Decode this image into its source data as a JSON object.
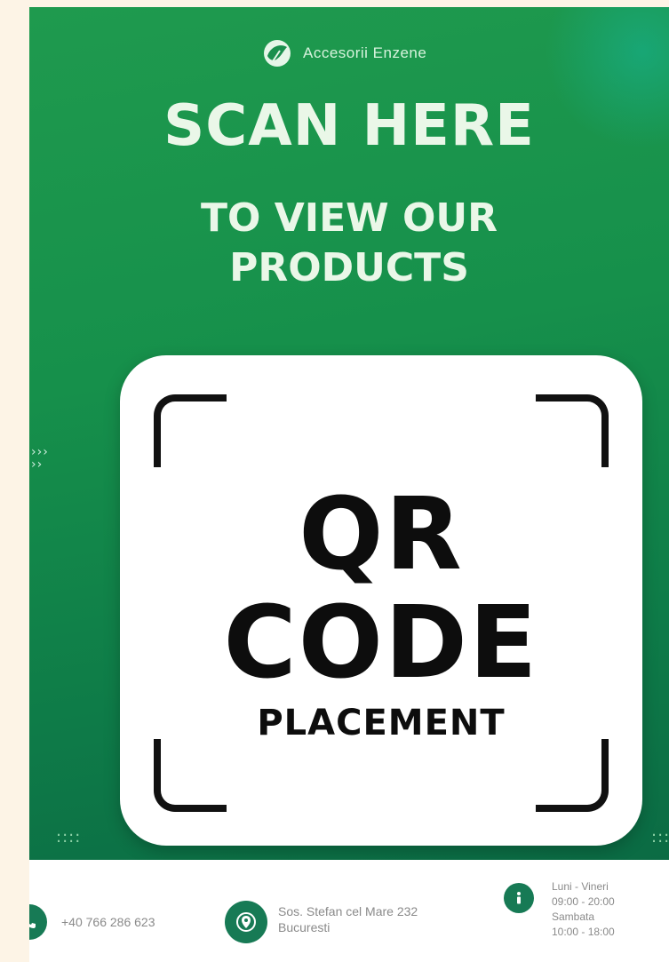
{
  "brand": {
    "name": "Accesorii Enzene",
    "logo_icon": "globe-leaf-icon"
  },
  "headline": "SCAN HERE",
  "subheadline": [
    "TO VIEW OUR",
    "PRODUCTS"
  ],
  "decor": {
    "arrows": "›››\n››",
    "dots": "::::"
  },
  "qr_placeholder": {
    "line1": "QR",
    "line2": "CODE",
    "line3": "PLACEMENT"
  },
  "footer": {
    "phone": "+40 766 286 623",
    "address": [
      "Sos. Stefan cel Mare 232",
      "Bucuresti"
    ],
    "hours": [
      "Luni - Vineri",
      "09:00 - 20:00",
      "Sambata",
      "10:00 - 18:00"
    ]
  },
  "colors": {
    "primary_green": "#16904b",
    "deep_green": "#0b6b44",
    "text_light": "#eaf7e8",
    "card": "#ffffff",
    "footer_text": "#8a8a8a"
  }
}
